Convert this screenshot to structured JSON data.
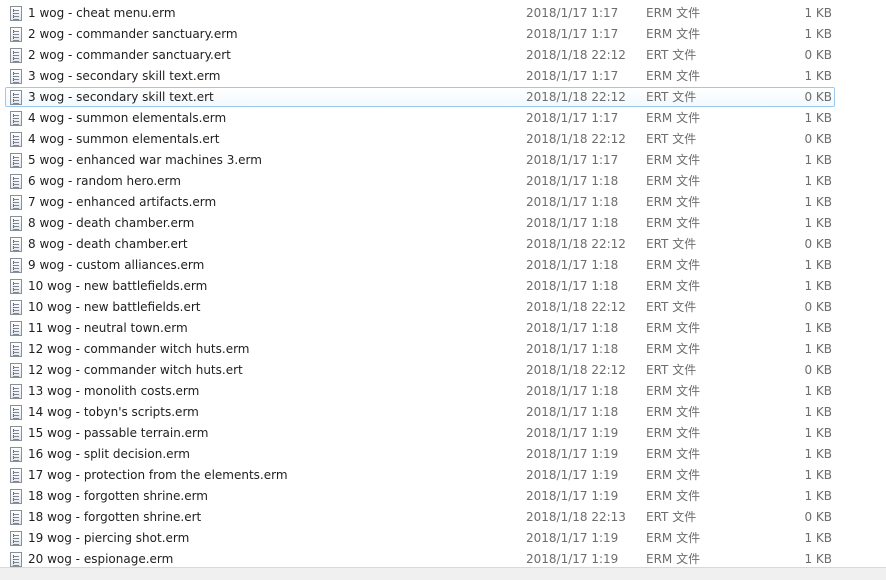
{
  "files": [
    {
      "name": "1 wog - cheat menu.erm",
      "date": "2018/1/17 1:17",
      "type": "ERM 文件",
      "size": "1 KB"
    },
    {
      "name": "2 wog - commander sanctuary.erm",
      "date": "2018/1/17 1:17",
      "type": "ERM 文件",
      "size": "1 KB"
    },
    {
      "name": "2 wog - commander sanctuary.ert",
      "date": "2018/1/18 22:12",
      "type": "ERT 文件",
      "size": "0 KB"
    },
    {
      "name": "3 wog - secondary skill text.erm",
      "date": "2018/1/17 1:17",
      "type": "ERM 文件",
      "size": "1 KB"
    },
    {
      "name": "3 wog - secondary skill text.ert",
      "date": "2018/1/18 22:12",
      "type": "ERT 文件",
      "size": "0 KB",
      "selected": true
    },
    {
      "name": "4 wog - summon elementals.erm",
      "date": "2018/1/17 1:17",
      "type": "ERM 文件",
      "size": "1 KB"
    },
    {
      "name": "4 wog - summon elementals.ert",
      "date": "2018/1/18 22:12",
      "type": "ERT 文件",
      "size": "0 KB"
    },
    {
      "name": "5 wog - enhanced war machines 3.erm",
      "date": "2018/1/17 1:17",
      "type": "ERM 文件",
      "size": "1 KB"
    },
    {
      "name": "6 wog - random hero.erm",
      "date": "2018/1/17 1:18",
      "type": "ERM 文件",
      "size": "1 KB"
    },
    {
      "name": "7 wog - enhanced artifacts.erm",
      "date": "2018/1/17 1:18",
      "type": "ERM 文件",
      "size": "1 KB"
    },
    {
      "name": "8 wog - death chamber.erm",
      "date": "2018/1/17 1:18",
      "type": "ERM 文件",
      "size": "1 KB"
    },
    {
      "name": "8 wog - death chamber.ert",
      "date": "2018/1/18 22:12",
      "type": "ERT 文件",
      "size": "0 KB"
    },
    {
      "name": "9 wog - custom alliances.erm",
      "date": "2018/1/17 1:18",
      "type": "ERM 文件",
      "size": "1 KB"
    },
    {
      "name": "10 wog - new battlefields.erm",
      "date": "2018/1/17 1:18",
      "type": "ERM 文件",
      "size": "1 KB"
    },
    {
      "name": "10 wog - new battlefields.ert",
      "date": "2018/1/18 22:12",
      "type": "ERT 文件",
      "size": "0 KB"
    },
    {
      "name": "11 wog - neutral town.erm",
      "date": "2018/1/17 1:18",
      "type": "ERM 文件",
      "size": "1 KB"
    },
    {
      "name": "12 wog - commander witch huts.erm",
      "date": "2018/1/17 1:18",
      "type": "ERM 文件",
      "size": "1 KB"
    },
    {
      "name": "12 wog - commander witch huts.ert",
      "date": "2018/1/18 22:12",
      "type": "ERT 文件",
      "size": "0 KB"
    },
    {
      "name": "13 wog - monolith costs.erm",
      "date": "2018/1/17 1:18",
      "type": "ERM 文件",
      "size": "1 KB"
    },
    {
      "name": "14 wog - tobyn's scripts.erm",
      "date": "2018/1/17 1:18",
      "type": "ERM 文件",
      "size": "1 KB"
    },
    {
      "name": "15 wog - passable terrain.erm",
      "date": "2018/1/17 1:19",
      "type": "ERM 文件",
      "size": "1 KB"
    },
    {
      "name": "16 wog - split decision.erm",
      "date": "2018/1/17 1:19",
      "type": "ERM 文件",
      "size": "1 KB"
    },
    {
      "name": "17 wog - protection from the elements.erm",
      "date": "2018/1/17 1:19",
      "type": "ERM 文件",
      "size": "1 KB"
    },
    {
      "name": "18 wog - forgotten shrine.erm",
      "date": "2018/1/17 1:19",
      "type": "ERM 文件",
      "size": "1 KB"
    },
    {
      "name": "18 wog - forgotten shrine.ert",
      "date": "2018/1/18 22:13",
      "type": "ERT 文件",
      "size": "0 KB"
    },
    {
      "name": "19 wog - piercing shot.erm",
      "date": "2018/1/17 1:19",
      "type": "ERM 文件",
      "size": "1 KB"
    },
    {
      "name": "20 wog - espionage.erm",
      "date": "2018/1/17 1:19",
      "type": "ERM 文件",
      "size": "1 KB"
    }
  ]
}
